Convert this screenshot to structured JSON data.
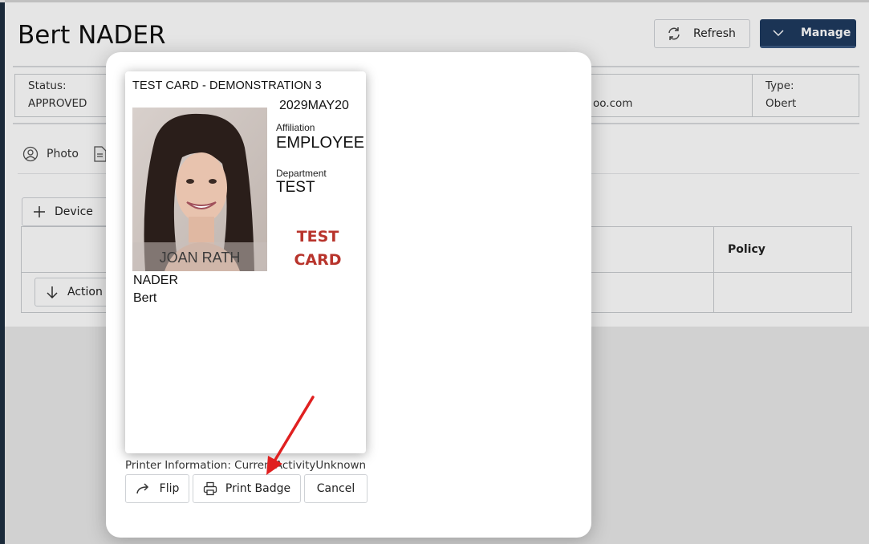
{
  "page": {
    "title": "Bert NADER",
    "refresh_label": "Refresh",
    "manage_label": "Manage",
    "info": [
      {
        "key": "Status:",
        "value": "APPROVED"
      },
      {
        "key": "",
        "value": "oo.com"
      },
      {
        "key": "Type:",
        "value": "Obert"
      }
    ],
    "tabs": [
      {
        "label": "Photo"
      }
    ],
    "device_label": "Device",
    "table": {
      "headers": [
        "Policy"
      ]
    },
    "action_label": "Action"
  },
  "dialog": {
    "card": {
      "title": "TEST CARD - DEMONSTRATION 3",
      "date": "2029MAY20",
      "affiliation_label": "Affiliation",
      "affiliation_value": "EMPLOYEE",
      "department_label": "Department",
      "department_value": "TEST",
      "watermark_line1": "TEST",
      "watermark_line2": "CARD",
      "last_name": "NADER",
      "first_name": "Bert",
      "photo_caption": "JOAN RATH"
    },
    "printer_info": "Printer Information: CurrentActivityUnknown",
    "buttons": {
      "flip": "Flip",
      "print_badge": "Print Badge",
      "cancel": "Cancel"
    }
  },
  "colors": {
    "accent": "#1f3a5f",
    "test_card_red": "#b8342c",
    "annotation_arrow": "#e02020"
  }
}
